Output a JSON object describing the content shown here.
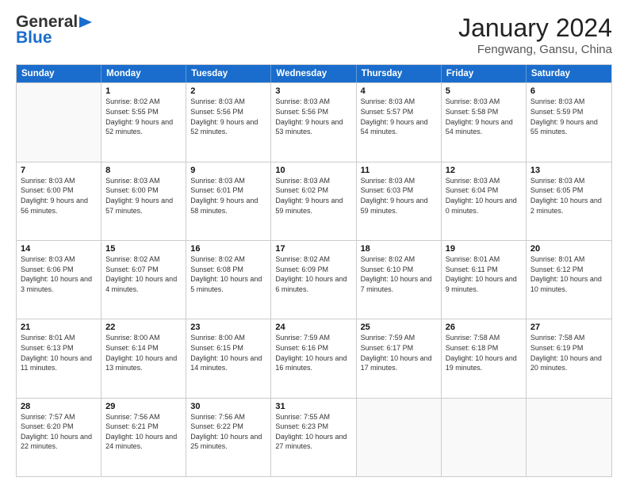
{
  "header": {
    "logo_general": "General",
    "logo_blue": "Blue",
    "title": "January 2024",
    "subtitle": "Fengwang, Gansu, China"
  },
  "weekdays": [
    "Sunday",
    "Monday",
    "Tuesday",
    "Wednesday",
    "Thursday",
    "Friday",
    "Saturday"
  ],
  "weeks": [
    [
      {
        "day": "",
        "empty": true
      },
      {
        "day": "1",
        "sunrise": "8:02 AM",
        "sunset": "5:55 PM",
        "daylight": "9 hours and 52 minutes."
      },
      {
        "day": "2",
        "sunrise": "8:03 AM",
        "sunset": "5:56 PM",
        "daylight": "9 hours and 52 minutes."
      },
      {
        "day": "3",
        "sunrise": "8:03 AM",
        "sunset": "5:56 PM",
        "daylight": "9 hours and 53 minutes."
      },
      {
        "day": "4",
        "sunrise": "8:03 AM",
        "sunset": "5:57 PM",
        "daylight": "9 hours and 54 minutes."
      },
      {
        "day": "5",
        "sunrise": "8:03 AM",
        "sunset": "5:58 PM",
        "daylight": "9 hours and 54 minutes."
      },
      {
        "day": "6",
        "sunrise": "8:03 AM",
        "sunset": "5:59 PM",
        "daylight": "9 hours and 55 minutes."
      }
    ],
    [
      {
        "day": "7",
        "sunrise": "8:03 AM",
        "sunset": "6:00 PM",
        "daylight": "9 hours and 56 minutes."
      },
      {
        "day": "8",
        "sunrise": "8:03 AM",
        "sunset": "6:00 PM",
        "daylight": "9 hours and 57 minutes."
      },
      {
        "day": "9",
        "sunrise": "8:03 AM",
        "sunset": "6:01 PM",
        "daylight": "9 hours and 58 minutes."
      },
      {
        "day": "10",
        "sunrise": "8:03 AM",
        "sunset": "6:02 PM",
        "daylight": "9 hours and 59 minutes."
      },
      {
        "day": "11",
        "sunrise": "8:03 AM",
        "sunset": "6:03 PM",
        "daylight": "9 hours and 59 minutes."
      },
      {
        "day": "12",
        "sunrise": "8:03 AM",
        "sunset": "6:04 PM",
        "daylight": "10 hours and 0 minutes."
      },
      {
        "day": "13",
        "sunrise": "8:03 AM",
        "sunset": "6:05 PM",
        "daylight": "10 hours and 2 minutes."
      }
    ],
    [
      {
        "day": "14",
        "sunrise": "8:03 AM",
        "sunset": "6:06 PM",
        "daylight": "10 hours and 3 minutes."
      },
      {
        "day": "15",
        "sunrise": "8:02 AM",
        "sunset": "6:07 PM",
        "daylight": "10 hours and 4 minutes."
      },
      {
        "day": "16",
        "sunrise": "8:02 AM",
        "sunset": "6:08 PM",
        "daylight": "10 hours and 5 minutes."
      },
      {
        "day": "17",
        "sunrise": "8:02 AM",
        "sunset": "6:09 PM",
        "daylight": "10 hours and 6 minutes."
      },
      {
        "day": "18",
        "sunrise": "8:02 AM",
        "sunset": "6:10 PM",
        "daylight": "10 hours and 7 minutes."
      },
      {
        "day": "19",
        "sunrise": "8:01 AM",
        "sunset": "6:11 PM",
        "daylight": "10 hours and 9 minutes."
      },
      {
        "day": "20",
        "sunrise": "8:01 AM",
        "sunset": "6:12 PM",
        "daylight": "10 hours and 10 minutes."
      }
    ],
    [
      {
        "day": "21",
        "sunrise": "8:01 AM",
        "sunset": "6:13 PM",
        "daylight": "10 hours and 11 minutes."
      },
      {
        "day": "22",
        "sunrise": "8:00 AM",
        "sunset": "6:14 PM",
        "daylight": "10 hours and 13 minutes."
      },
      {
        "day": "23",
        "sunrise": "8:00 AM",
        "sunset": "6:15 PM",
        "daylight": "10 hours and 14 minutes."
      },
      {
        "day": "24",
        "sunrise": "7:59 AM",
        "sunset": "6:16 PM",
        "daylight": "10 hours and 16 minutes."
      },
      {
        "day": "25",
        "sunrise": "7:59 AM",
        "sunset": "6:17 PM",
        "daylight": "10 hours and 17 minutes."
      },
      {
        "day": "26",
        "sunrise": "7:58 AM",
        "sunset": "6:18 PM",
        "daylight": "10 hours and 19 minutes."
      },
      {
        "day": "27",
        "sunrise": "7:58 AM",
        "sunset": "6:19 PM",
        "daylight": "10 hours and 20 minutes."
      }
    ],
    [
      {
        "day": "28",
        "sunrise": "7:57 AM",
        "sunset": "6:20 PM",
        "daylight": "10 hours and 22 minutes."
      },
      {
        "day": "29",
        "sunrise": "7:56 AM",
        "sunset": "6:21 PM",
        "daylight": "10 hours and 24 minutes."
      },
      {
        "day": "30",
        "sunrise": "7:56 AM",
        "sunset": "6:22 PM",
        "daylight": "10 hours and 25 minutes."
      },
      {
        "day": "31",
        "sunrise": "7:55 AM",
        "sunset": "6:23 PM",
        "daylight": "10 hours and 27 minutes."
      },
      {
        "day": "",
        "empty": true
      },
      {
        "day": "",
        "empty": true
      },
      {
        "day": "",
        "empty": true
      }
    ]
  ],
  "labels": {
    "sunrise": "Sunrise:",
    "sunset": "Sunset:",
    "daylight": "Daylight:"
  }
}
